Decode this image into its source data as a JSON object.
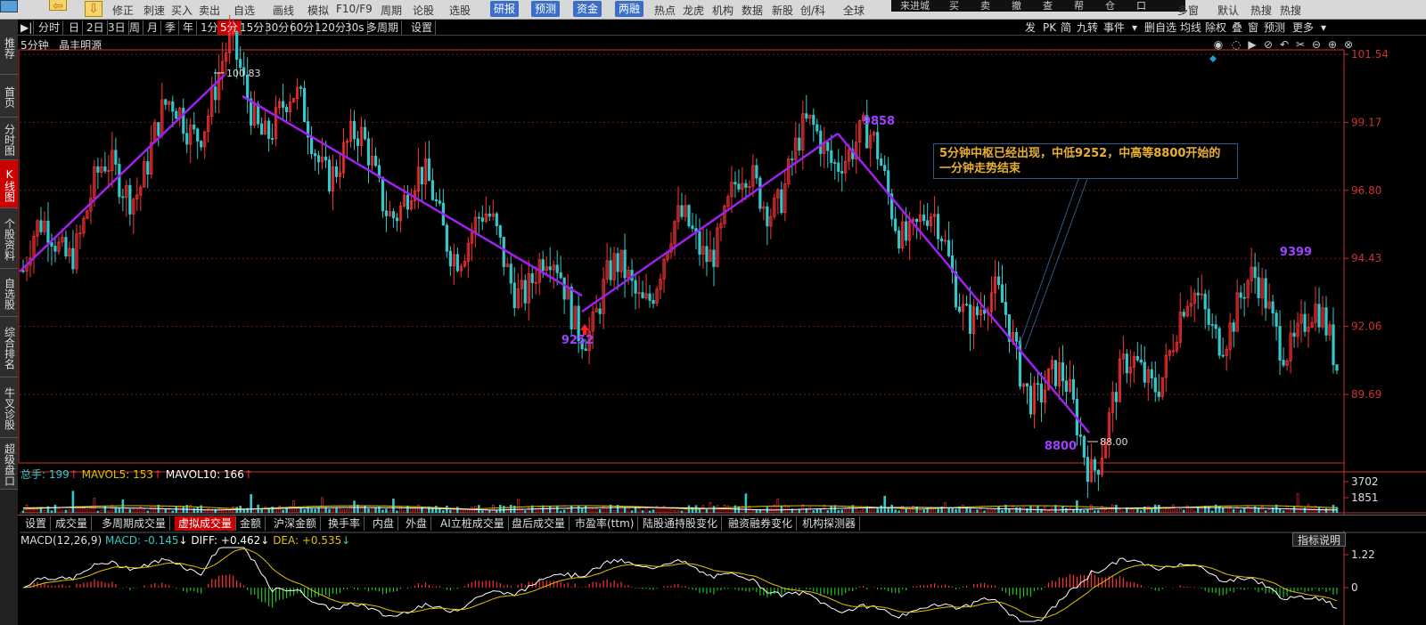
{
  "topbar": {
    "items": [
      "修正",
      "刺速",
      "买入",
      "卖出",
      "自选",
      "画线",
      "模拟",
      "F10/F9",
      "周期",
      "论股",
      "选股",
      "研报",
      "预测",
      "资金",
      "两融",
      "热点",
      "龙虎",
      "机构",
      "数据",
      "新股",
      "创/科",
      "全球",
      "多窗",
      "默认",
      "热搜",
      "热搜"
    ],
    "highlighted": [
      "研报",
      "预测",
      "资金",
      "两融"
    ],
    "dark_block_items": [
      "来进城",
      "买",
      "卖",
      "撤",
      "查",
      "帮",
      "仓",
      "口"
    ]
  },
  "sidebar": {
    "items": [
      "推荐",
      "首页",
      "分时图",
      "K线图",
      "个股资料",
      "自选股",
      "综合排名",
      "牛叉诊股",
      "超级盘口"
    ],
    "active": "K线图"
  },
  "periodbar": {
    "items": [
      "分时",
      "日",
      "2日",
      "3日",
      "周",
      "月",
      "季",
      "年",
      "1分",
      "5分",
      "15分",
      "30分",
      "60分",
      "120分",
      "30s",
      "多周期",
      "设置"
    ],
    "selected": "5分",
    "right_items": [
      "发",
      "PK",
      "简",
      "九转",
      "事件",
      "▾",
      "删自选",
      "均线",
      "除权",
      "叠",
      "窗",
      "预测",
      "更多",
      "▾"
    ]
  },
  "stock": {
    "period_label": "5分钟",
    "name": "晶丰明源"
  },
  "chart_data": {
    "type": "candlestick",
    "price_axis_labels": [
      "101.54",
      "99.17",
      "96.80",
      "94.43",
      "92.06",
      "89.69"
    ],
    "price_axis_values": [
      101.54,
      99.17,
      96.8,
      94.43,
      92.06,
      89.69
    ],
    "price_range": [
      87.0,
      102.0
    ],
    "high_label": "100.83",
    "low_label": "88.00",
    "annotations": [
      "9252",
      "9858",
      "8800",
      "9399"
    ],
    "note_text": "5分钟中枢已经出现，中低9252，中高等8800开始的一分钟走势结束",
    "zigzag_points": [
      {
        "bar": 0,
        "price": 94.0
      },
      {
        "bar": 58,
        "price": 100.83
      },
      {
        "bar": 62,
        "price": 100.2
      },
      {
        "bar": 160,
        "price": 92.6
      },
      {
        "bar": 230,
        "price": 98.9
      },
      {
        "bar": 300,
        "price": 88.0
      }
    ],
    "bar_count": 370,
    "volume": {
      "legend_total": "总手: 199",
      "legend_mavol5": "MAVOL5: 153",
      "legend_mavol10": "MAVOL10: 166",
      "axis_labels": [
        "3702",
        "1851"
      ]
    },
    "macd": {
      "legend_title": "MACD(12,26,9)",
      "legend_macd": "MACD: -0.145",
      "legend_diff": "DIFF: +0.462",
      "legend_dea": "DEA: +0.535",
      "axis_labels": [
        "1.22",
        "0"
      ]
    }
  },
  "indicator_tabs": {
    "items": [
      "设置",
      "成交量",
      "多周期成交量",
      "虚拟成交量",
      "金额",
      "沪深金额",
      "换手率",
      "内盘",
      "外盘",
      "AI立桩成交量",
      "盘后成交量",
      "市盈率(ttm)",
      "陆股通持股变化",
      "融资融券变化",
      "机构探测器"
    ],
    "selected": "虚拟成交量"
  },
  "explain_button": "指标说明",
  "colors": {
    "up": "#ff3232",
    "down": "#35c7c9",
    "zigzag": "#a020f0",
    "annotation_purple": "#a040ff",
    "axis_red": "#c83232"
  }
}
